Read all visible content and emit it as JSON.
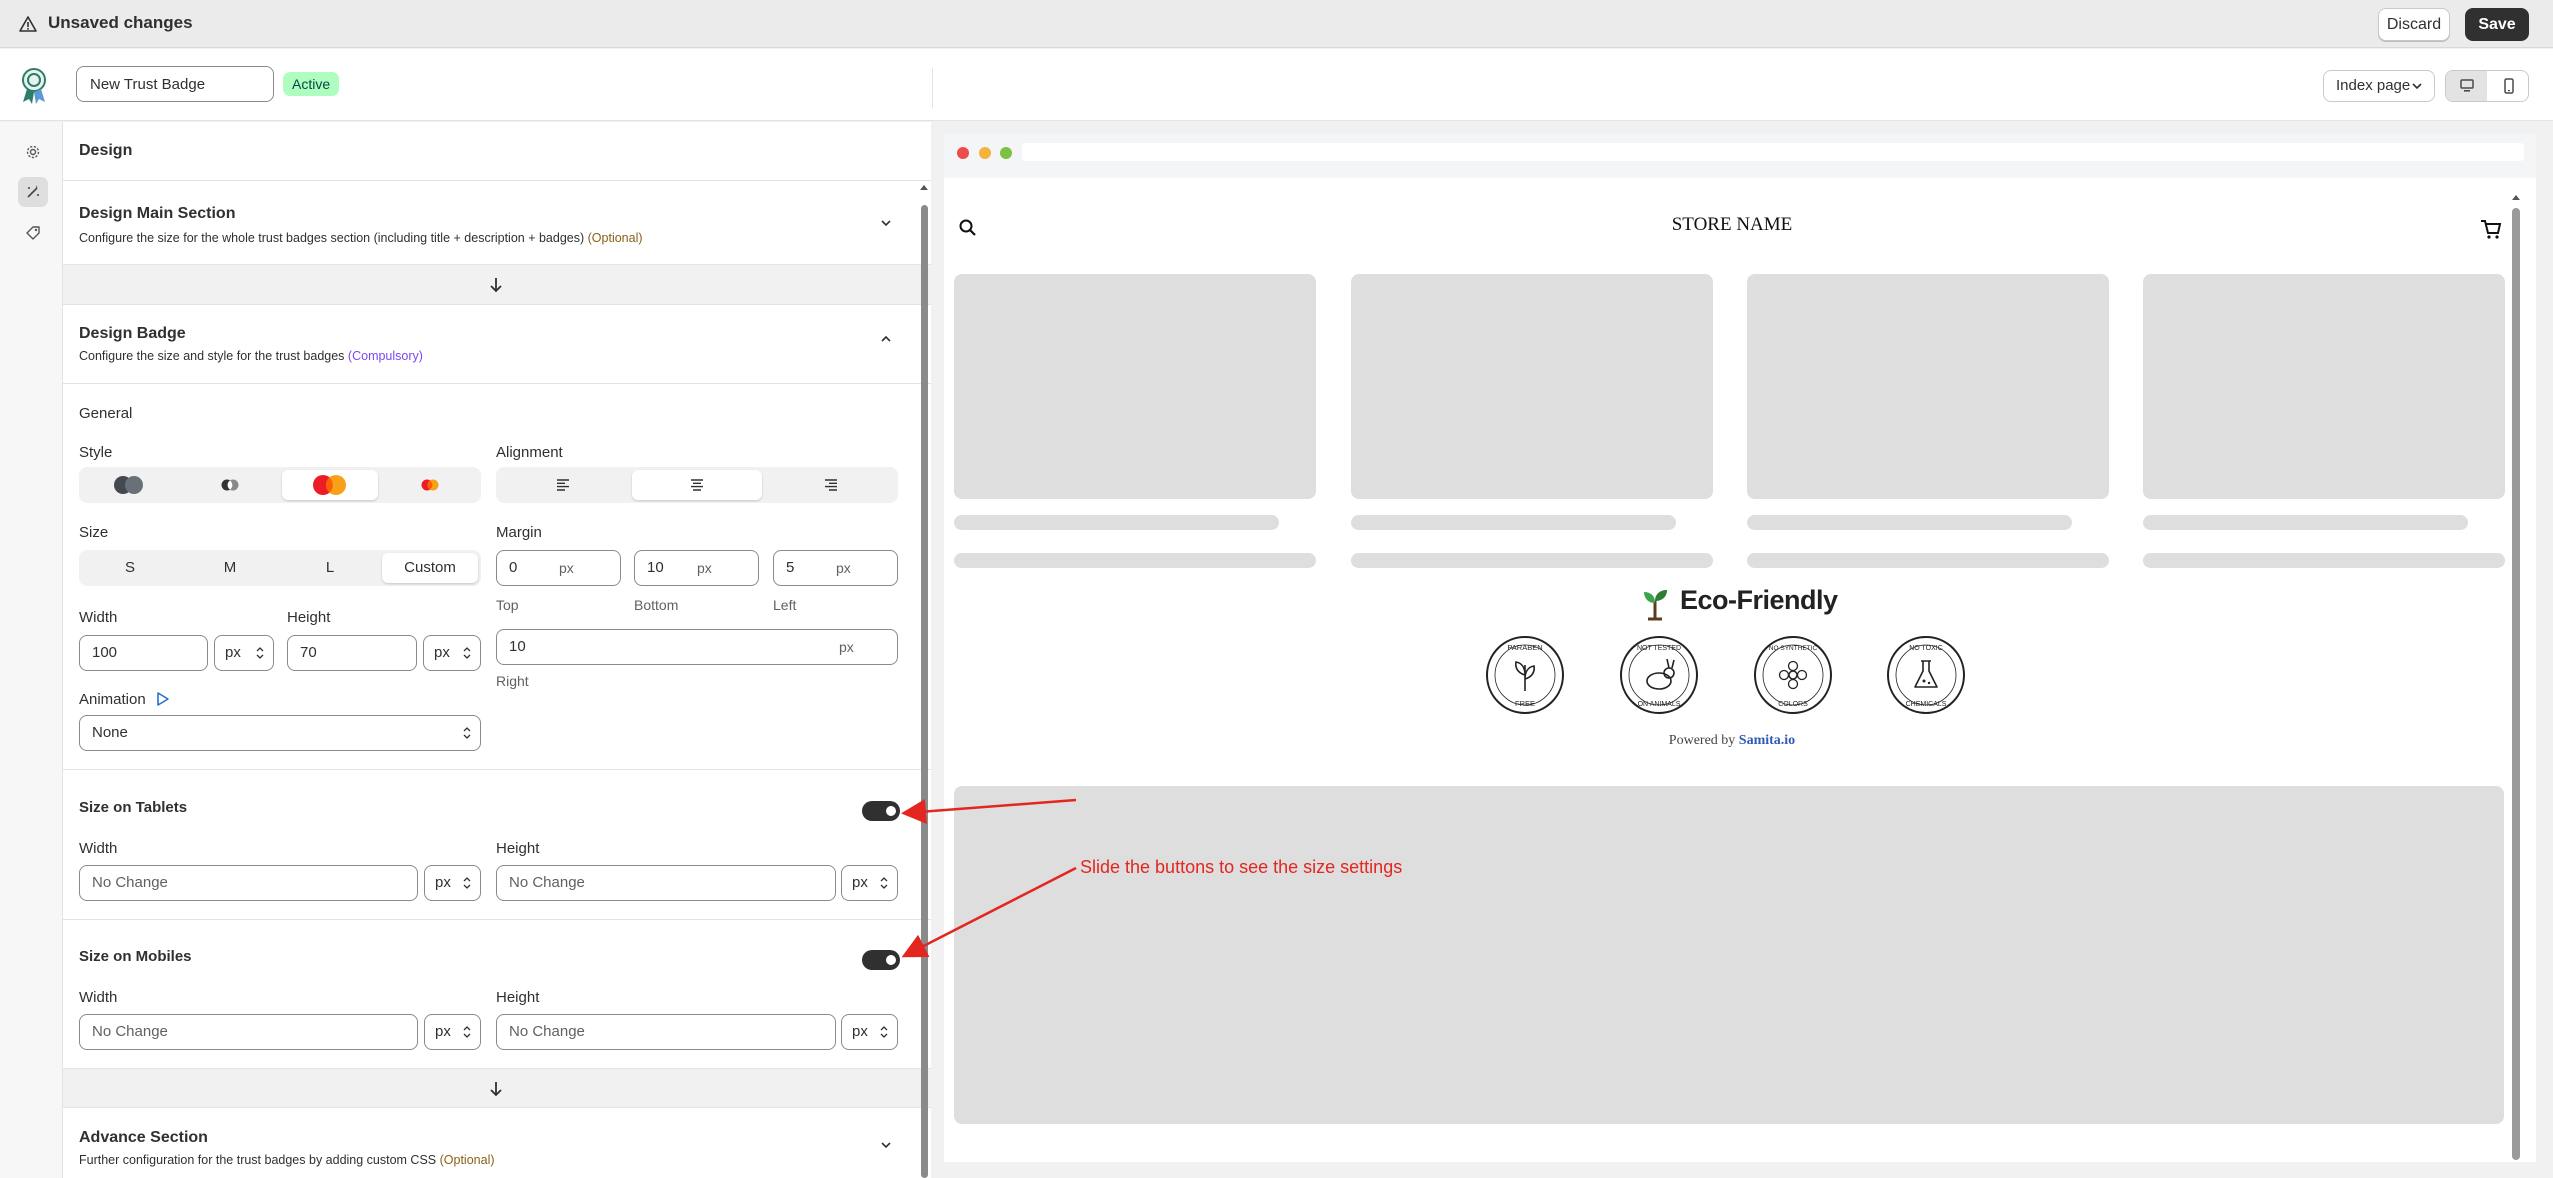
{
  "topbar": {
    "title": "Unsaved changes",
    "discard_label": "Discard",
    "save_label": "Save"
  },
  "header": {
    "badge_name": "New Trust Badge",
    "status": "Active",
    "page_select": "Index page"
  },
  "panel": {
    "title": "Design",
    "main_section": {
      "title": "Design Main Section",
      "desc": "Configure the size for the whole trust badges section (including title + description + badges)",
      "tag": "(Optional)"
    },
    "badge_section": {
      "title": "Design Badge",
      "desc": "Configure the size and style for the trust badges",
      "tag": "(Compulsory)"
    },
    "general": "General",
    "style_label": "Style",
    "alignment_label": "Alignment",
    "size_label": "Size",
    "sizes": [
      "S",
      "M",
      "L",
      "Custom"
    ],
    "margin_label": "Margin",
    "margin": {
      "top": "0",
      "bottom": "10",
      "left": "5",
      "right": "10",
      "unit": "px",
      "top_label": "Top",
      "bottom_label": "Bottom",
      "left_label": "Left",
      "right_label": "Right"
    },
    "width_label": "Width",
    "height_label": "Height",
    "width_value": "100",
    "height_value": "70",
    "unit": "px",
    "animation_label": "Animation",
    "animation_value": "None",
    "tablets": {
      "title": "Size on Tablets",
      "width_label": "Width",
      "height_label": "Height",
      "width_ph": "No Change",
      "height_ph": "No Change",
      "unit": "px"
    },
    "mobiles": {
      "title": "Size on Mobiles",
      "width_label": "Width",
      "height_label": "Height",
      "width_ph": "No Change",
      "height_ph": "No Change",
      "unit": "px"
    },
    "advance": {
      "title": "Advance Section",
      "desc": "Further configuration for the trust badges by adding custom CSS",
      "tag": "(Optional)"
    }
  },
  "preview": {
    "store_name": "STORE NAME",
    "eco_title": "Eco-Friendly",
    "badges": [
      {
        "top": "PARABEN",
        "bottom": "FREE",
        "icon": "leaf-icon"
      },
      {
        "top": "NOT TESTED",
        "bottom": "ON ANIMALS",
        "icon": "rabbit-icon"
      },
      {
        "top": "NO SYNTHETIC",
        "bottom": "COLORS",
        "icon": "flower-icon"
      },
      {
        "top": "NO TOXIC",
        "bottom": "CHEMICALS",
        "icon": "flask-icon"
      }
    ],
    "powered_prefix": "Powered by",
    "powered_brand": "Samita.io"
  },
  "annotation": {
    "text": "Slide the buttons to see the size settings",
    "color": "#e3261f"
  },
  "colors": {
    "accent_dark": "#303030",
    "active_bg": "#affebf",
    "optional": "#8a6116",
    "compulsory": "#7b47f1"
  }
}
